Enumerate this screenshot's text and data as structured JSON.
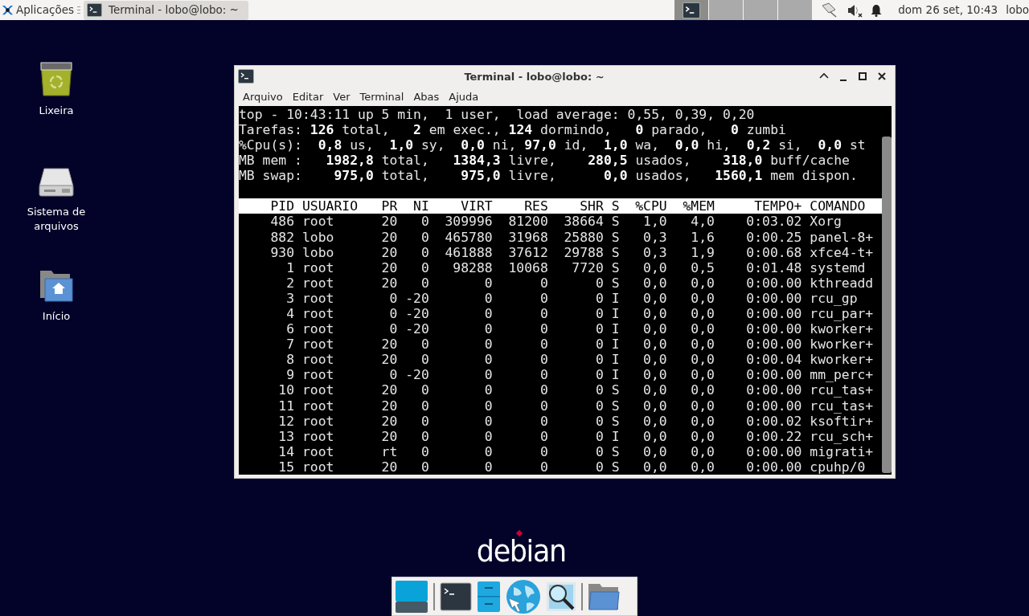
{
  "top_panel": {
    "app_menu": "Aplicações",
    "tasks": [
      {
        "title": "Terminal - lobo@lobo: ~",
        "selected": true
      }
    ],
    "workspaces": [
      {
        "selected": true
      },
      {
        "selected": false
      },
      {
        "selected": false
      },
      {
        "selected": false
      }
    ],
    "clock": "dom 26 set, 10:43",
    "user": "lobo"
  },
  "desktop_icons": [
    {
      "label": "Lixeira",
      "kind": "trash"
    },
    {
      "label": "Sistema de arquivos",
      "kind": "drive"
    },
    {
      "label": "Início",
      "kind": "home"
    }
  ],
  "terminal": {
    "title": "Terminal - lobo@lobo: ~",
    "menu": [
      "Arquivo",
      "Editar",
      "Ver",
      "Terminal",
      "Abas",
      "Ajuda"
    ],
    "summary": [
      "top - 10:43:11 up 5 min,  1 user,  load average: 0,55, 0,39, 0,20",
      "Tarefas: **126** total,   **2** em exec., **124** dormindo,   **0** parado,   **0** zumbi",
      "%Cpu(s):  **0,8** us,  **1,0** sy,  **0,0** ni, **97,0** id,  **1,0** wa,  **0,0** hi,  **0,2** si,  **0,0** st",
      "MB mem :   **1982,8** total,   **1384,3** livre,    **280,5** usados,    **318,0** buff/cache",
      "MB swap:    **975,0** total,    **975,0** livre,      **0,0** usados,   **1560,1** mem dispon."
    ],
    "columns": [
      "PID",
      "USUARIO",
      "PR",
      "NI",
      "VIRT",
      "RES",
      "SHR",
      "S",
      "%CPU",
      "%MEM",
      "TEMPO+",
      "COMANDO"
    ],
    "rows": [
      [
        "486",
        "root",
        "20",
        "0",
        "309996",
        "81200",
        "38664",
        "S",
        "1,0",
        "4,0",
        "0:03.02",
        "Xorg"
      ],
      [
        "882",
        "lobo",
        "20",
        "0",
        "465780",
        "31968",
        "25880",
        "S",
        "0,3",
        "1,6",
        "0:00.25",
        "panel-8+"
      ],
      [
        "930",
        "lobo",
        "20",
        "0",
        "461888",
        "37612",
        "29788",
        "S",
        "0,3",
        "1,9",
        "0:00.68",
        "xfce4-t+"
      ],
      [
        "1",
        "root",
        "20",
        "0",
        "98288",
        "10068",
        "7720",
        "S",
        "0,0",
        "0,5",
        "0:01.48",
        "systemd"
      ],
      [
        "2",
        "root",
        "20",
        "0",
        "0",
        "0",
        "0",
        "S",
        "0,0",
        "0,0",
        "0:00.00",
        "kthreadd"
      ],
      [
        "3",
        "root",
        "0",
        "-20",
        "0",
        "0",
        "0",
        "I",
        "0,0",
        "0,0",
        "0:00.00",
        "rcu_gp"
      ],
      [
        "4",
        "root",
        "0",
        "-20",
        "0",
        "0",
        "0",
        "I",
        "0,0",
        "0,0",
        "0:00.00",
        "rcu_par+"
      ],
      [
        "6",
        "root",
        "0",
        "-20",
        "0",
        "0",
        "0",
        "I",
        "0,0",
        "0,0",
        "0:00.00",
        "kworker+"
      ],
      [
        "7",
        "root",
        "20",
        "0",
        "0",
        "0",
        "0",
        "I",
        "0,0",
        "0,0",
        "0:00.00",
        "kworker+"
      ],
      [
        "8",
        "root",
        "20",
        "0",
        "0",
        "0",
        "0",
        "I",
        "0,0",
        "0,0",
        "0:00.04",
        "kworker+"
      ],
      [
        "9",
        "root",
        "0",
        "-20",
        "0",
        "0",
        "0",
        "I",
        "0,0",
        "0,0",
        "0:00.00",
        "mm_perc+"
      ],
      [
        "10",
        "root",
        "20",
        "0",
        "0",
        "0",
        "0",
        "S",
        "0,0",
        "0,0",
        "0:00.00",
        "rcu_tas+"
      ],
      [
        "11",
        "root",
        "20",
        "0",
        "0",
        "0",
        "0",
        "S",
        "0,0",
        "0,0",
        "0:00.00",
        "rcu_tas+"
      ],
      [
        "12",
        "root",
        "20",
        "0",
        "0",
        "0",
        "0",
        "S",
        "0,0",
        "0,0",
        "0:00.02",
        "ksoftir+"
      ],
      [
        "13",
        "root",
        "20",
        "0",
        "0",
        "0",
        "0",
        "I",
        "0,0",
        "0,0",
        "0:00.22",
        "rcu_sch+"
      ],
      [
        "14",
        "root",
        "rt",
        "0",
        "0",
        "0",
        "0",
        "S",
        "0,0",
        "0,0",
        "0:00.00",
        "migrati+"
      ],
      [
        "15",
        "root",
        "20",
        "0",
        "0",
        "0",
        "0",
        "S",
        "0,0",
        "0,0",
        "0:00.00",
        "cpuhp/0"
      ]
    ]
  },
  "wallpaper_logo": "debian",
  "dock": [
    {
      "kind": "show-desktop"
    },
    {
      "kind": "separator"
    },
    {
      "kind": "terminal"
    },
    {
      "kind": "files"
    },
    {
      "kind": "browser"
    },
    {
      "kind": "app-finder"
    },
    {
      "kind": "separator"
    },
    {
      "kind": "folder"
    }
  ]
}
